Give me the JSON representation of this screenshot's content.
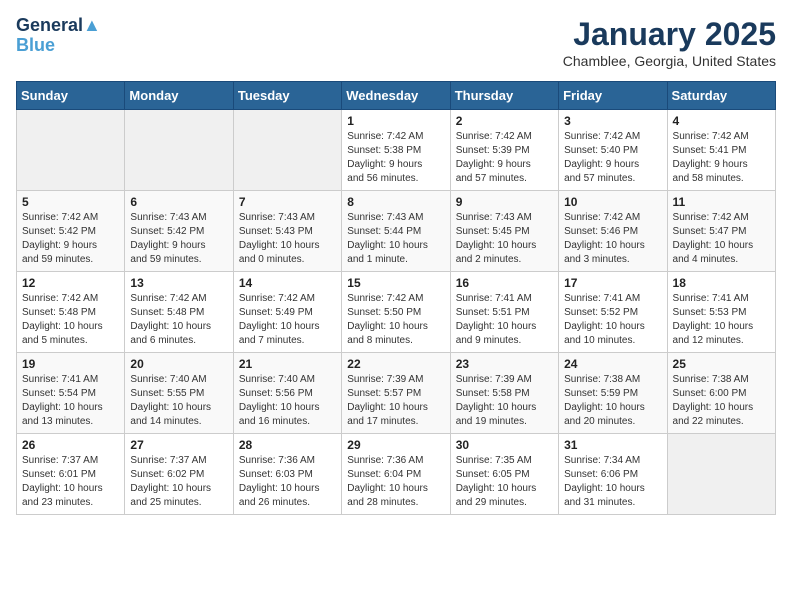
{
  "header": {
    "logo_line1": "General",
    "logo_line2": "Blue",
    "month": "January 2025",
    "location": "Chamblee, Georgia, United States"
  },
  "weekdays": [
    "Sunday",
    "Monday",
    "Tuesday",
    "Wednesday",
    "Thursday",
    "Friday",
    "Saturday"
  ],
  "weeks": [
    [
      {
        "day": "",
        "info": ""
      },
      {
        "day": "",
        "info": ""
      },
      {
        "day": "",
        "info": ""
      },
      {
        "day": "1",
        "info": "Sunrise: 7:42 AM\nSunset: 5:38 PM\nDaylight: 9 hours\nand 56 minutes."
      },
      {
        "day": "2",
        "info": "Sunrise: 7:42 AM\nSunset: 5:39 PM\nDaylight: 9 hours\nand 57 minutes."
      },
      {
        "day": "3",
        "info": "Sunrise: 7:42 AM\nSunset: 5:40 PM\nDaylight: 9 hours\nand 57 minutes."
      },
      {
        "day": "4",
        "info": "Sunrise: 7:42 AM\nSunset: 5:41 PM\nDaylight: 9 hours\nand 58 minutes."
      }
    ],
    [
      {
        "day": "5",
        "info": "Sunrise: 7:42 AM\nSunset: 5:42 PM\nDaylight: 9 hours\nand 59 minutes."
      },
      {
        "day": "6",
        "info": "Sunrise: 7:43 AM\nSunset: 5:42 PM\nDaylight: 9 hours\nand 59 minutes."
      },
      {
        "day": "7",
        "info": "Sunrise: 7:43 AM\nSunset: 5:43 PM\nDaylight: 10 hours\nand 0 minutes."
      },
      {
        "day": "8",
        "info": "Sunrise: 7:43 AM\nSunset: 5:44 PM\nDaylight: 10 hours\nand 1 minute."
      },
      {
        "day": "9",
        "info": "Sunrise: 7:43 AM\nSunset: 5:45 PM\nDaylight: 10 hours\nand 2 minutes."
      },
      {
        "day": "10",
        "info": "Sunrise: 7:42 AM\nSunset: 5:46 PM\nDaylight: 10 hours\nand 3 minutes."
      },
      {
        "day": "11",
        "info": "Sunrise: 7:42 AM\nSunset: 5:47 PM\nDaylight: 10 hours\nand 4 minutes."
      }
    ],
    [
      {
        "day": "12",
        "info": "Sunrise: 7:42 AM\nSunset: 5:48 PM\nDaylight: 10 hours\nand 5 minutes."
      },
      {
        "day": "13",
        "info": "Sunrise: 7:42 AM\nSunset: 5:48 PM\nDaylight: 10 hours\nand 6 minutes."
      },
      {
        "day": "14",
        "info": "Sunrise: 7:42 AM\nSunset: 5:49 PM\nDaylight: 10 hours\nand 7 minutes."
      },
      {
        "day": "15",
        "info": "Sunrise: 7:42 AM\nSunset: 5:50 PM\nDaylight: 10 hours\nand 8 minutes."
      },
      {
        "day": "16",
        "info": "Sunrise: 7:41 AM\nSunset: 5:51 PM\nDaylight: 10 hours\nand 9 minutes."
      },
      {
        "day": "17",
        "info": "Sunrise: 7:41 AM\nSunset: 5:52 PM\nDaylight: 10 hours\nand 10 minutes."
      },
      {
        "day": "18",
        "info": "Sunrise: 7:41 AM\nSunset: 5:53 PM\nDaylight: 10 hours\nand 12 minutes."
      }
    ],
    [
      {
        "day": "19",
        "info": "Sunrise: 7:41 AM\nSunset: 5:54 PM\nDaylight: 10 hours\nand 13 minutes."
      },
      {
        "day": "20",
        "info": "Sunrise: 7:40 AM\nSunset: 5:55 PM\nDaylight: 10 hours\nand 14 minutes."
      },
      {
        "day": "21",
        "info": "Sunrise: 7:40 AM\nSunset: 5:56 PM\nDaylight: 10 hours\nand 16 minutes."
      },
      {
        "day": "22",
        "info": "Sunrise: 7:39 AM\nSunset: 5:57 PM\nDaylight: 10 hours\nand 17 minutes."
      },
      {
        "day": "23",
        "info": "Sunrise: 7:39 AM\nSunset: 5:58 PM\nDaylight: 10 hours\nand 19 minutes."
      },
      {
        "day": "24",
        "info": "Sunrise: 7:38 AM\nSunset: 5:59 PM\nDaylight: 10 hours\nand 20 minutes."
      },
      {
        "day": "25",
        "info": "Sunrise: 7:38 AM\nSunset: 6:00 PM\nDaylight: 10 hours\nand 22 minutes."
      }
    ],
    [
      {
        "day": "26",
        "info": "Sunrise: 7:37 AM\nSunset: 6:01 PM\nDaylight: 10 hours\nand 23 minutes."
      },
      {
        "day": "27",
        "info": "Sunrise: 7:37 AM\nSunset: 6:02 PM\nDaylight: 10 hours\nand 25 minutes."
      },
      {
        "day": "28",
        "info": "Sunrise: 7:36 AM\nSunset: 6:03 PM\nDaylight: 10 hours\nand 26 minutes."
      },
      {
        "day": "29",
        "info": "Sunrise: 7:36 AM\nSunset: 6:04 PM\nDaylight: 10 hours\nand 28 minutes."
      },
      {
        "day": "30",
        "info": "Sunrise: 7:35 AM\nSunset: 6:05 PM\nDaylight: 10 hours\nand 29 minutes."
      },
      {
        "day": "31",
        "info": "Sunrise: 7:34 AM\nSunset: 6:06 PM\nDaylight: 10 hours\nand 31 minutes."
      },
      {
        "day": "",
        "info": ""
      }
    ]
  ]
}
